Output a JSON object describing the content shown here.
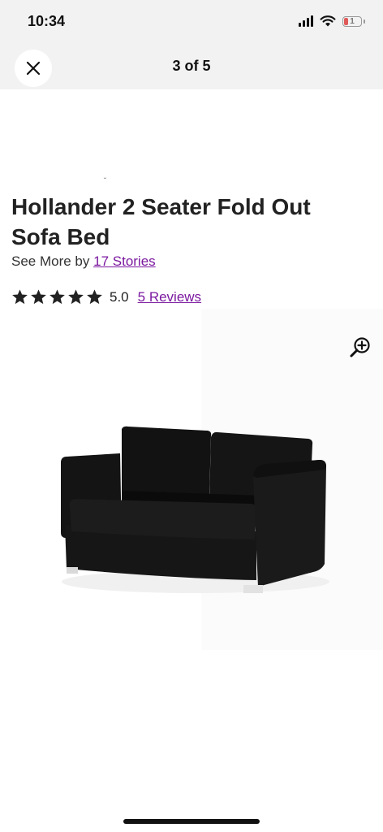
{
  "status_bar": {
    "time": "10:34",
    "battery_level": "1",
    "icons": [
      "signal-icon",
      "wifi-icon",
      "battery-icon"
    ]
  },
  "header": {
    "title": "3 of 5",
    "close_icon": "close-icon"
  },
  "product": {
    "title": "Hollander 2 Seater Fold Out Sofa Bed",
    "see_more_prefix": "See More by",
    "brand": "17 Stories",
    "rating_value": "5.0",
    "rating_fraction": 1.0,
    "stars": 5,
    "reviews_label": "5 Reviews",
    "zoom_icon": "zoom-in-icon",
    "image_subject": "black two-seater sofa bed"
  },
  "colors": {
    "accent_link": "#7b189f",
    "header_bg": "#f2f2f2",
    "text": "#222222"
  }
}
